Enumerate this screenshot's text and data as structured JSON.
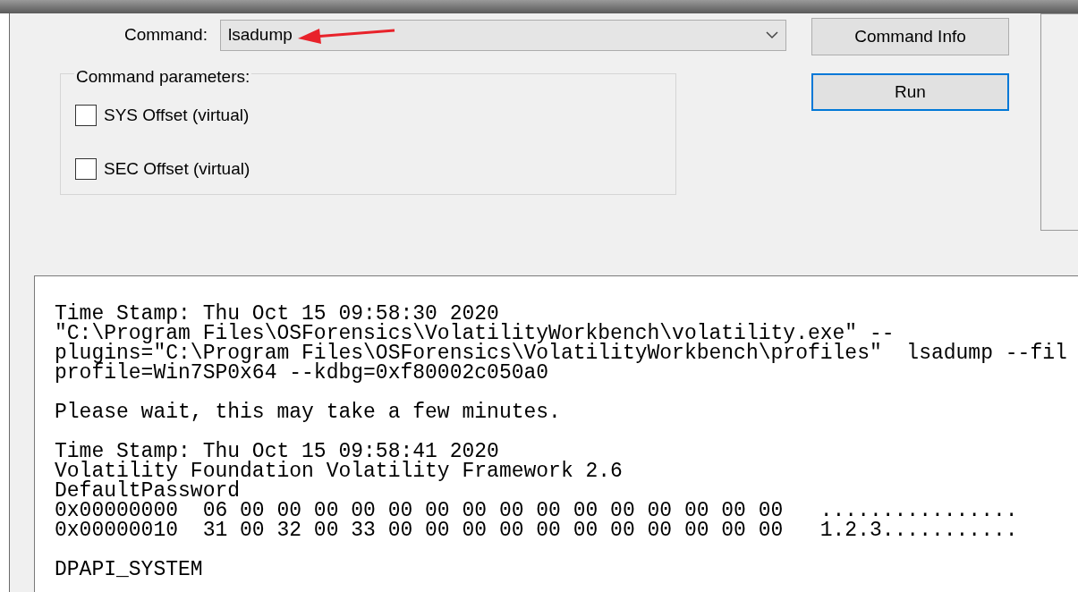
{
  "command": {
    "label": "Command:",
    "value": "lsadump"
  },
  "parameters": {
    "title": "Command parameters:",
    "options": [
      {
        "label": "SYS Offset (virtual)",
        "checked": false
      },
      {
        "label": "SEC Offset (virtual)",
        "checked": false
      }
    ]
  },
  "buttons": [
    {
      "label": "Command Info",
      "focused": false
    },
    {
      "label": "Run",
      "focused": true
    }
  ],
  "output": {
    "blocks": [
      [
        "Time Stamp: Thu Oct 15 09:58:30 2020",
        "\"C:\\Program Files\\OSForensics\\VolatilityWorkbench\\volatility.exe\" --",
        "plugins=\"C:\\Program Files\\OSForensics\\VolatilityWorkbench\\profiles\"  lsadump --fil",
        "profile=Win7SP0x64 --kdbg=0xf80002c050a0"
      ],
      [
        "Please wait, this may take a few minutes."
      ],
      [
        "Time Stamp: Thu Oct 15 09:58:41 2020",
        "Volatility Foundation Volatility Framework 2.6",
        "DefaultPassword",
        "0x00000000  06 00 00 00 00 00 00 00 00 00 00 00 00 00 00 00   ................",
        "0x00000010  31 00 32 00 33 00 00 00 00 00 00 00 00 00 00 00   1.2.3..........."
      ],
      [
        "DPAPI_SYSTEM"
      ]
    ]
  }
}
